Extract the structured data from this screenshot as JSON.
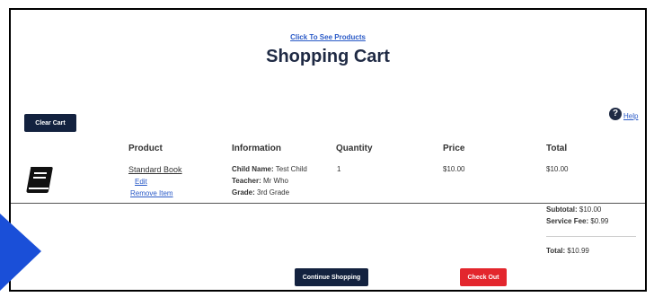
{
  "header": {
    "see_products_link": "Click To See Products",
    "title": "Shopping Cart"
  },
  "toolbar": {
    "clear_cart_label": "Clear Cart",
    "help_icon": "question-circle-icon",
    "help_label": "Help"
  },
  "table": {
    "columns": [
      "Product",
      "Information",
      "Quantity",
      "Price",
      "Total"
    ],
    "rows": [
      {
        "icon": "book-icon",
        "product_name": "Standard Book",
        "edit_label": "Edit",
        "remove_label": "Remove Item",
        "info": [
          {
            "label": "Child Name:",
            "value": " Test Child"
          },
          {
            "label": "Teacher:",
            "value": " Mr Who"
          },
          {
            "label": "Grade:",
            "value": " 3rd Grade"
          }
        ],
        "quantity": "1",
        "price": "$10.00",
        "total": "$10.00"
      }
    ]
  },
  "summary": {
    "subtotal_label": "Subtotal:",
    "subtotal_value": " $10.00",
    "service_fee_label": "Service Fee:",
    "service_fee_value": " $0.99",
    "total_label": "Total:",
    "total_value": " $10.99"
  },
  "footer": {
    "continue_label": "Continue Shopping",
    "checkout_label": "Check Out"
  },
  "colors": {
    "navy": "#13223f",
    "checkout_red": "#e3262d",
    "link_blue": "#2a5ac7",
    "arrow_blue": "#1a4fd8"
  }
}
